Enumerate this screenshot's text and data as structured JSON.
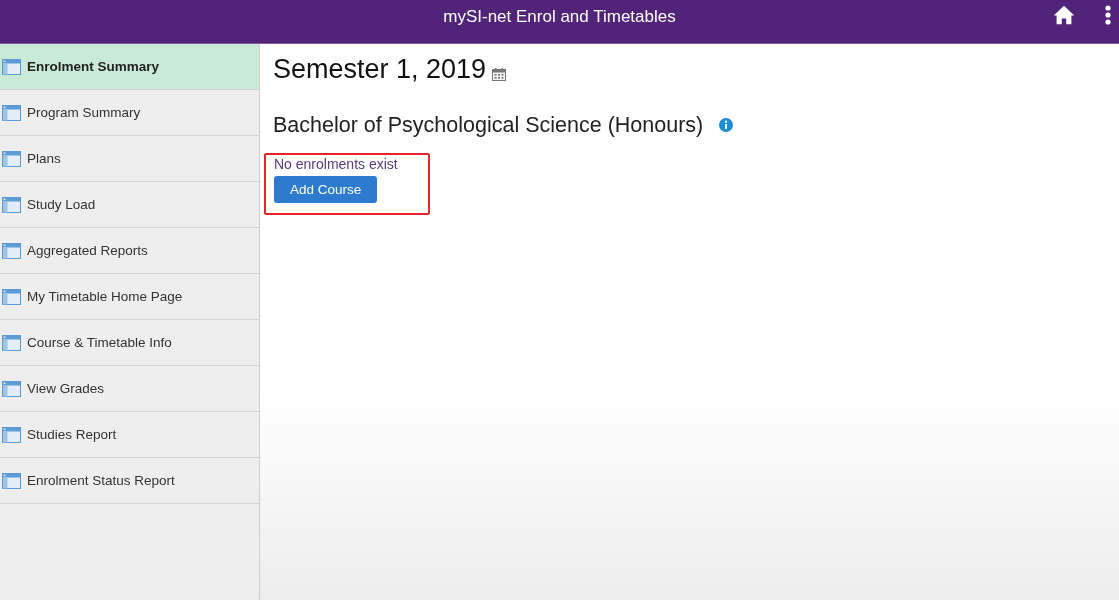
{
  "header": {
    "title": "mySI-net Enrol and Timetables"
  },
  "sidebar": {
    "items": [
      {
        "label": "Enrolment Summary",
        "selected": true
      },
      {
        "label": "Program Summary",
        "selected": false
      },
      {
        "label": "Plans",
        "selected": false
      },
      {
        "label": "Study Load",
        "selected": false
      },
      {
        "label": "Aggregated Reports",
        "selected": false
      },
      {
        "label": "My Timetable Home Page",
        "selected": false
      },
      {
        "label": "Course & Timetable Info",
        "selected": false
      },
      {
        "label": "View Grades",
        "selected": false
      },
      {
        "label": "Studies Report",
        "selected": false
      },
      {
        "label": "Enrolment Status Report",
        "selected": false
      }
    ]
  },
  "main": {
    "term": "Semester 1, 2019",
    "program": "Bachelor of Psychological Science (Honours)",
    "enrolments": {
      "message": "No enrolments exist",
      "highlighted": true,
      "button": "Add Course"
    }
  }
}
